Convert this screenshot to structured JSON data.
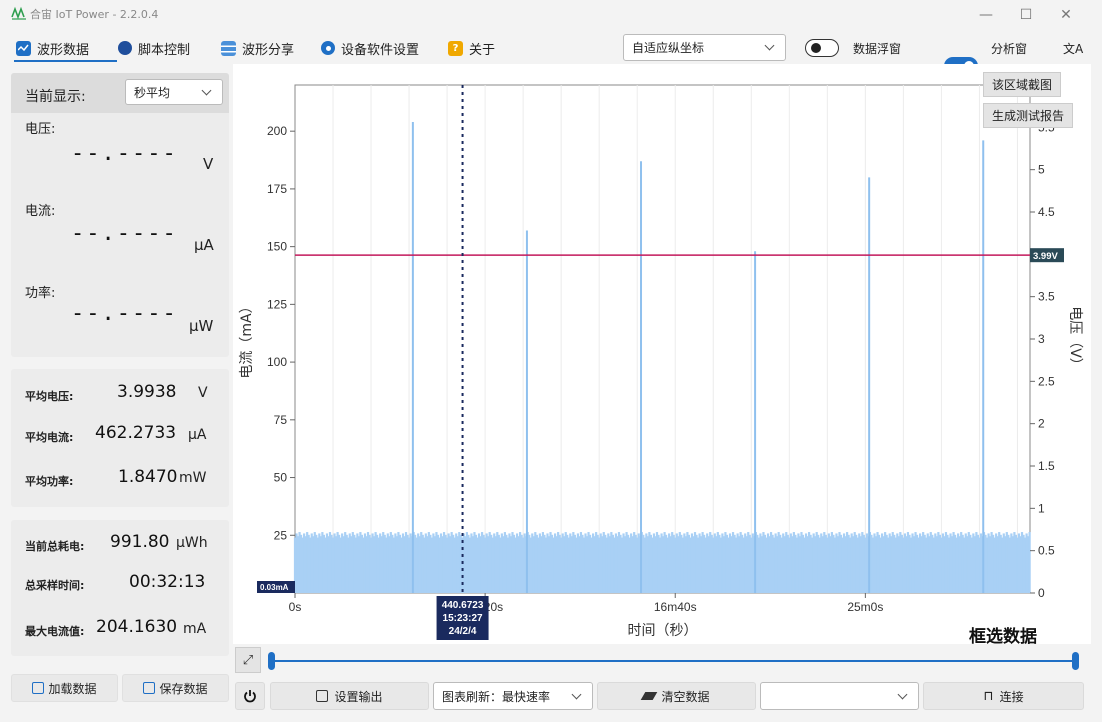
{
  "window": {
    "title": "合宙 IoT Power - 2.2.0.4",
    "minimize": "—",
    "maximize": "☐",
    "close": "✕"
  },
  "toolbar": {
    "tabs": [
      {
        "label": "波形数据",
        "icon": "waveform-icon"
      },
      {
        "label": "脚本控制",
        "icon": "script-icon"
      },
      {
        "label": "波形分享",
        "icon": "share-icon"
      },
      {
        "label": "设备软件设置",
        "icon": "gear-icon"
      },
      {
        "label": "关于",
        "icon": "help-icon"
      }
    ],
    "axis_mode": "自适应纵坐标",
    "float_window_label": "数据浮窗",
    "float_window_on": false,
    "analysis_label": "分析窗",
    "analysis_on": true,
    "translate_icon": "文A"
  },
  "left": {
    "display_label": "当前显示:",
    "display_mode": "秒平均",
    "voltage_label": "电压:",
    "voltage_value": "--.----",
    "voltage_unit": "V",
    "current_label": "电流:",
    "current_value": "--.----",
    "current_unit": "μA",
    "power_label": "功率:",
    "power_value": "--.----",
    "power_unit": "μW",
    "avg_voltage_label": "平均电压:",
    "avg_voltage": "3.9938",
    "avg_voltage_unit": "V",
    "avg_current_label": "平均电流:",
    "avg_current": "462.2733",
    "avg_current_unit": "μA",
    "avg_power_label": "平均功率:",
    "avg_power": "1.8470",
    "avg_power_unit": "mW",
    "energy_label": "当前总耗电:",
    "energy": "991.80",
    "energy_unit": "μWh",
    "time_label": "总采样时间:",
    "time": "00:32:13",
    "max_label": "最大电流值:",
    "max": "204.1630",
    "max_unit": "mA",
    "load_label": "加载数据",
    "save_label": "保存数据"
  },
  "chart": {
    "screenshot_btn": "该区域截图",
    "report_btn": "生成测试报告",
    "ylabel": "电流（mA）",
    "y2label": "电压（V）",
    "xlabel": "时间（秒）",
    "select_label": "框选数据",
    "min_marker": "0.03mA",
    "voltage_marker": "3.99V",
    "cursor_line1": "440.6723",
    "cursor_line2": "15:23:27",
    "cursor_line3": "24/2/4",
    "color_fill": "#a9d0f5",
    "color_voltage": "#c2185b",
    "color_marker": "#1a2a5e"
  },
  "chart_data": {
    "type": "area",
    "ylim": [
      0,
      220
    ],
    "y2lim": [
      0,
      6
    ],
    "xlim": [
      0,
      1933
    ],
    "yticks": [
      25,
      50,
      75,
      100,
      125,
      150,
      175,
      200
    ],
    "y2ticks": [
      0,
      0.5,
      1,
      1.5,
      2,
      2.5,
      3,
      3.5,
      4,
      4.5,
      5,
      5.5
    ],
    "xticks": [
      {
        "value": 0,
        "label": "0s"
      },
      {
        "value": 500,
        "label": "8m20s"
      },
      {
        "value": 1000,
        "label": "16m40s"
      },
      {
        "value": 1500,
        "label": "25m0s"
      }
    ],
    "baseline_current": 26,
    "spikes": [
      {
        "x": 310,
        "y": 204
      },
      {
        "x": 610,
        "y": 157
      },
      {
        "x": 910,
        "y": 187
      },
      {
        "x": 1210,
        "y": 148
      },
      {
        "x": 1510,
        "y": 180
      },
      {
        "x": 1810,
        "y": 196
      }
    ],
    "voltage": 3.99,
    "cursor_x": 440.6723
  },
  "bottom": {
    "settings_output": "设置输出",
    "refresh_label": "图表刷新：最快速率",
    "clear_label": "清空数据",
    "port_value": "",
    "connect_label": "连接"
  }
}
